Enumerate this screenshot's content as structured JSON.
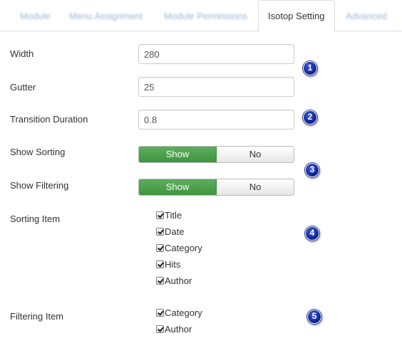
{
  "tabs": [
    {
      "label": "Module",
      "active": false
    },
    {
      "label": "Menu Assignment",
      "active": false
    },
    {
      "label": "Module Permissions",
      "active": false
    },
    {
      "label": "Isotop Setting",
      "active": true
    },
    {
      "label": "Advanced",
      "active": false
    }
  ],
  "form": {
    "width": {
      "label": "Width",
      "value": "280"
    },
    "gutter": {
      "label": "Gutter",
      "value": "25"
    },
    "transition": {
      "label": "Transition Duration",
      "value": "0.8"
    },
    "show_sorting": {
      "label": "Show Sorting",
      "on_label": "Show",
      "off_label": "No",
      "selected": "Show"
    },
    "show_filtering": {
      "label": "Show Filtering",
      "on_label": "Show",
      "off_label": "No",
      "selected": "Show"
    },
    "sorting_item": {
      "label": "Sorting Item",
      "options": [
        {
          "label": "Title",
          "checked": true
        },
        {
          "label": "Date",
          "checked": true
        },
        {
          "label": "Category",
          "checked": true
        },
        {
          "label": "Hits",
          "checked": true
        },
        {
          "label": "Author",
          "checked": true
        }
      ]
    },
    "filtering_item": {
      "label": "Filtering Item",
      "options": [
        {
          "label": "Category",
          "checked": true
        },
        {
          "label": "Author",
          "checked": true
        }
      ]
    }
  },
  "badges": [
    "1",
    "2",
    "3",
    "4",
    "5"
  ],
  "colors": {
    "toggle_active": "#47a447",
    "badge": "#0a1f8c",
    "tab_blurred": "#9fb6d2"
  }
}
